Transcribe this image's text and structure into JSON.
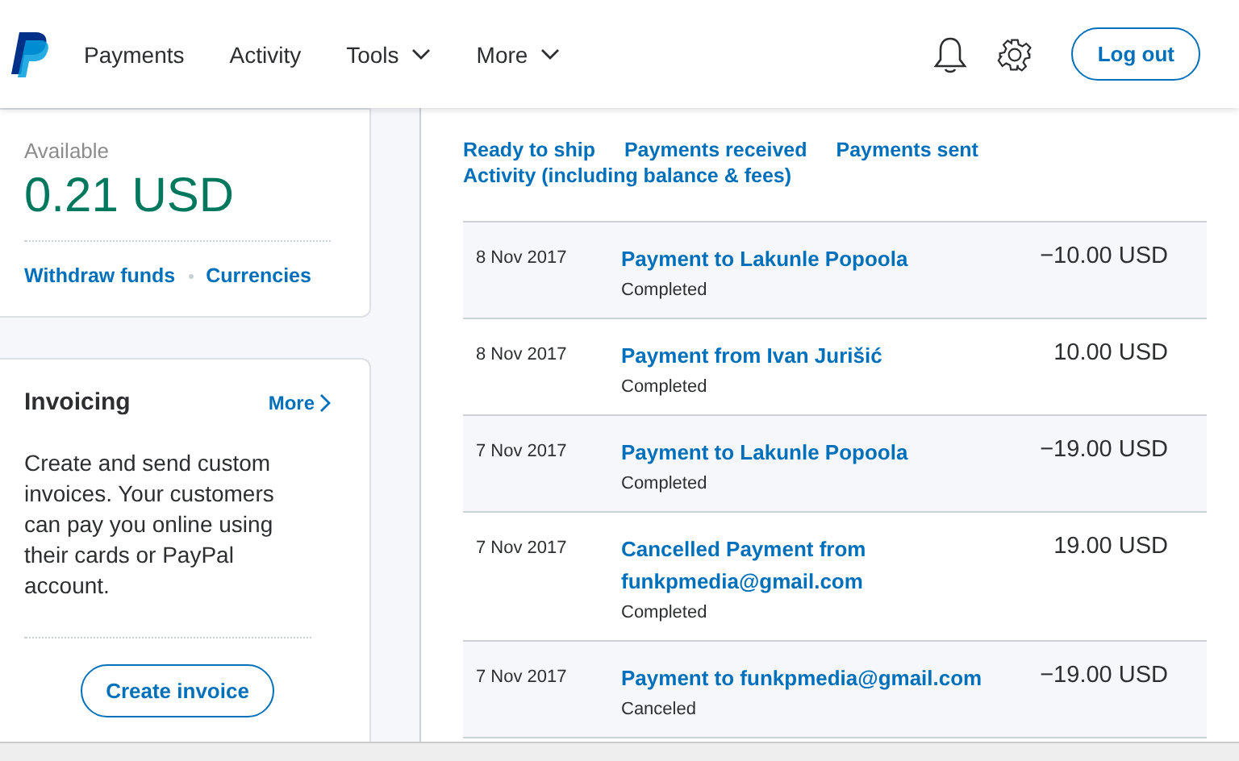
{
  "nav": {
    "items": [
      {
        "label": "Payments",
        "dropdown": false
      },
      {
        "label": "Activity",
        "dropdown": false
      },
      {
        "label": "Tools",
        "dropdown": true
      },
      {
        "label": "More",
        "dropdown": true
      }
    ],
    "logout": "Log out"
  },
  "balance": {
    "label": "Available",
    "amount": "0.21 USD",
    "links": [
      "Withdraw funds",
      "Currencies"
    ]
  },
  "invoicing": {
    "title": "Invoicing",
    "more": "More",
    "text": "Create and send custom invoices. Your customers can pay you online using their cards or PayPal account.",
    "button": "Create invoice"
  },
  "filters": [
    "Ready to ship",
    "Payments received",
    "Payments sent",
    "Activity (including balance & fees)"
  ],
  "transactions": [
    {
      "date": "8 Nov 2017",
      "title": "Payment to Lakunle Popoola",
      "status": "Completed",
      "amount": "−10.00 USD"
    },
    {
      "date": "8 Nov 2017",
      "title": "Payment from Ivan Jurišić",
      "status": "Completed",
      "amount": "10.00 USD"
    },
    {
      "date": "7 Nov 2017",
      "title": "Payment to Lakunle Popoola",
      "status": "Completed",
      "amount": "−19.00 USD"
    },
    {
      "date": "7 Nov 2017",
      "title": "Cancelled Payment from funkpmedia@gmail.com",
      "status": "Completed",
      "amount": "19.00 USD"
    },
    {
      "date": "7 Nov 2017",
      "title": "Payment to funkpmedia@gmail.com",
      "status": "Canceled",
      "amount": "−19.00 USD"
    }
  ]
}
